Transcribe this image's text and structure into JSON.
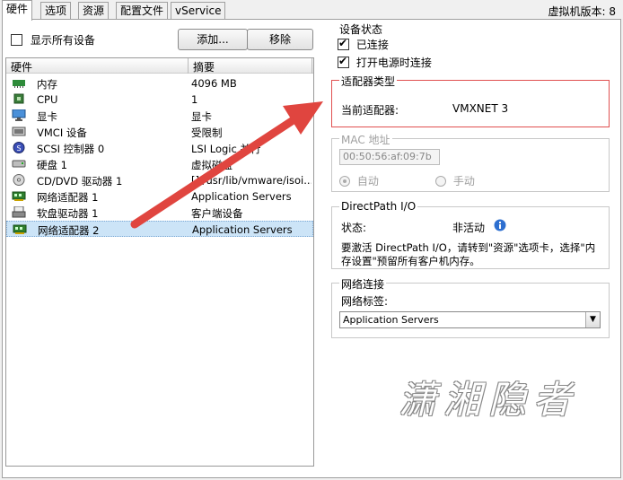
{
  "tabs": [
    {
      "label": "硬件",
      "active": true
    },
    {
      "label": "选项",
      "active": false
    },
    {
      "label": "资源",
      "active": false
    },
    {
      "label": "配置文件",
      "active": false
    },
    {
      "label": "vService",
      "active": false
    }
  ],
  "vm_version": "虚拟机版本: 8",
  "left": {
    "show_all_label": "显示所有设备",
    "show_all_checked": false,
    "add_button": "添加...",
    "remove_button": "移除",
    "columns": {
      "hardware": "硬件",
      "summary": "摘要"
    },
    "rows": [
      {
        "icon": "memory-icon",
        "name": "内存",
        "summary": "4096 MB",
        "selected": false
      },
      {
        "icon": "cpu-icon",
        "name": "CPU",
        "summary": "1",
        "selected": false
      },
      {
        "icon": "display-icon",
        "name": "显卡",
        "summary": "显卡",
        "selected": false
      },
      {
        "icon": "vmci-icon",
        "name": "VMCI 设备",
        "summary": "受限制",
        "selected": false
      },
      {
        "icon": "scsi-icon",
        "name": "SCSI 控制器  0",
        "summary": "LSI Logic 并行",
        "selected": false
      },
      {
        "icon": "harddisk-icon",
        "name": "硬盘  1",
        "summary": "虚拟磁盘",
        "selected": false
      },
      {
        "icon": "cdrom-icon",
        "name": "CD/DVD 驱动器  1",
        "summary": "[] /usr/lib/vmware/isoi...",
        "selected": false
      },
      {
        "icon": "nic-icon",
        "name": "网络适配器  1",
        "summary": "Application Servers",
        "selected": false
      },
      {
        "icon": "floppy-icon",
        "name": "软盘驱动器  1",
        "summary": "客户端设备",
        "selected": false
      },
      {
        "icon": "nic-icon",
        "name": "网络适配器  2",
        "summary": "Application Servers",
        "selected": true
      }
    ]
  },
  "right": {
    "device_status": {
      "title": "设备状态",
      "connected_label": "已连接",
      "connected_checked": true,
      "connect_power_on_label": "打开电源时连接",
      "connect_power_on_checked": true
    },
    "adapter_type": {
      "title": "适配器类型",
      "current_label": "当前适配器:",
      "current_value": "VMXNET 3"
    },
    "mac": {
      "title": "MAC 地址",
      "value": "00:50:56:af:09:7b",
      "auto_label": "自动",
      "manual_label": "手动",
      "auto_selected": true
    },
    "directpath": {
      "title": "DirectPath I/O",
      "status_label": "状态:",
      "status_value": "非活动",
      "note_line1": "要激活 DirectPath I/O，请转到\"资源\"选项卡，选择\"内",
      "note_line2": "存设置\"预留所有客户机内存。"
    },
    "network": {
      "title": "网络连接",
      "label_caption": "网络标签:",
      "selected_value": "Application Servers"
    }
  },
  "watermark": "潇湘隐者",
  "colors": {
    "arrow": "#e0453f",
    "highlight_box": "#e05050",
    "selection": "#cce4f7"
  }
}
